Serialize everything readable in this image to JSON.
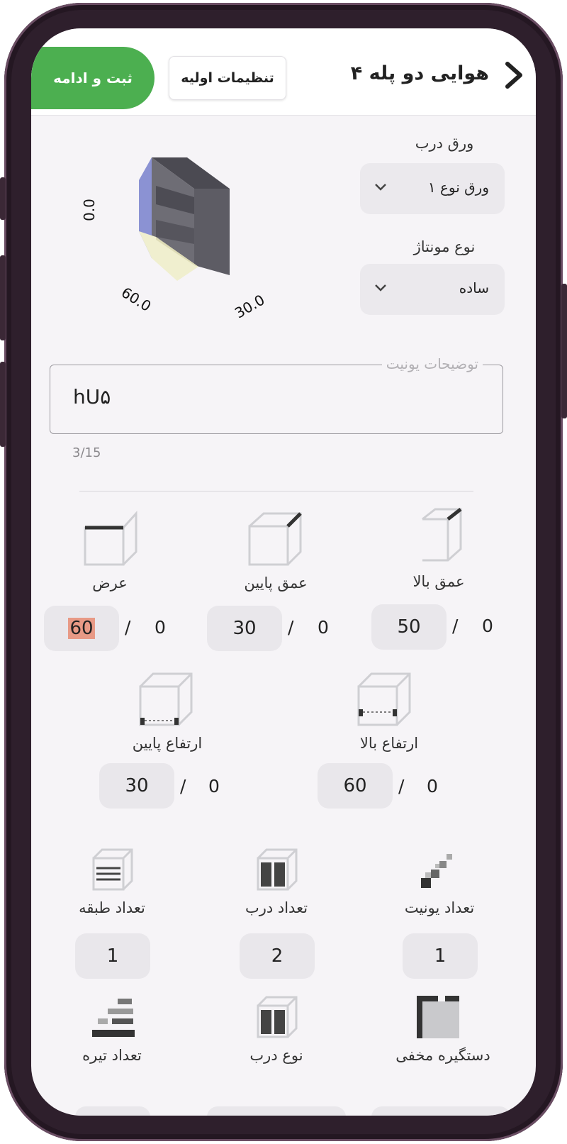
{
  "header": {
    "title": "هوایی دو پله ۴",
    "settings_label": "تنظیمات اولیه",
    "submit_label": "ثبت و ادامه"
  },
  "form": {
    "sheet_label": "ورق درب",
    "sheet_value": "ورق نوع ۱",
    "mount_label": "نوع مونتاژ",
    "mount_value": "ساده"
  },
  "preview": {
    "height_value": "0.0",
    "width_value": "60.0",
    "depth_value": "30.0"
  },
  "description": {
    "legend": "توضیحات یونیت",
    "value": "hU۵",
    "counter": "3/15"
  },
  "dimensions": [
    {
      "label": "عمق بالا",
      "value": "50",
      "zero": "0"
    },
    {
      "label": "عمق پایین",
      "value": "30",
      "zero": "0"
    },
    {
      "label": "عرض",
      "value": "60",
      "zero": "0"
    },
    {
      "label": "ارتفاع بالا",
      "value": "60",
      "zero": "0"
    },
    {
      "label": "ارتفاع پایین",
      "value": "30",
      "zero": "0"
    }
  ],
  "slash": "/",
  "counts": [
    {
      "label": "تعداد یونیت",
      "value": "1"
    },
    {
      "label": "تعداد درب",
      "value": "2"
    },
    {
      "label": "تعداد طبقه",
      "value": "1"
    }
  ],
  "options": [
    {
      "label": "دستگیره مخفی"
    },
    {
      "label": "نوع درب"
    },
    {
      "label": "تعداد تیره"
    }
  ],
  "colors": {
    "submit": "#4caf50",
    "highlight": "#e89a86",
    "bg": "#f6f4f7"
  }
}
